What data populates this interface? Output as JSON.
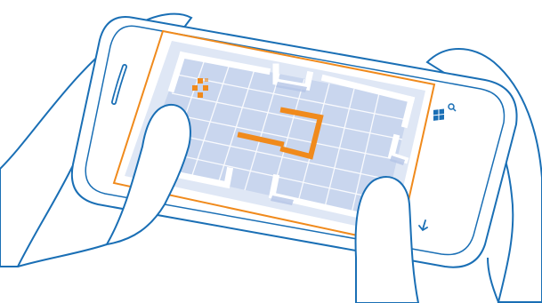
{
  "illustration": {
    "subject": "phone-held-landscape-playing-maze-game",
    "colors": {
      "outline": "#1a6fb5",
      "screen_border": "#f08a1c",
      "board_fill": "#c9d6ee",
      "board_shade": "#b4c4e6",
      "grid_line": "#ffffff",
      "wall": "#ffffff",
      "player": "#f08a1c",
      "hand_fill": "#ffffff"
    },
    "icons": {
      "search": "search-icon",
      "start": "windows-start-icon",
      "back": "back-arrow-icon"
    }
  }
}
